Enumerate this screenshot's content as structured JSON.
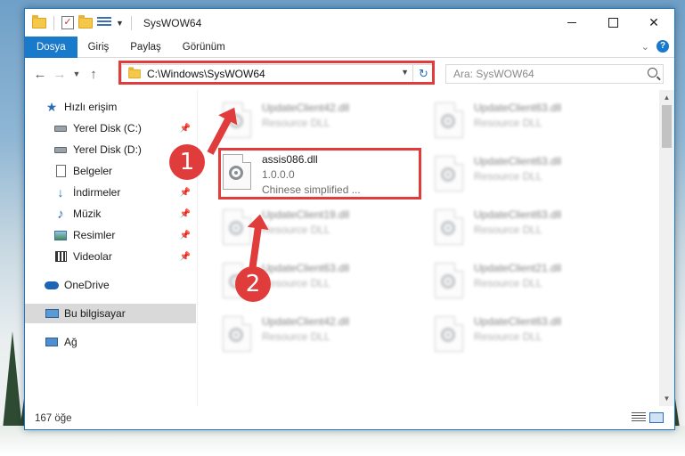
{
  "window": {
    "title": "SysWOW64"
  },
  "ribbon": {
    "tabs": [
      "Dosya",
      "Giriş",
      "Paylaş",
      "Görünüm"
    ],
    "help": "?"
  },
  "address": {
    "path": "C:\\Windows\\SysWOW64",
    "refresh_glyph": "↻"
  },
  "search": {
    "placeholder": "Ara: SysWOW64"
  },
  "sidebar": {
    "items": [
      {
        "label": "Hızlı erişim",
        "icon": "star-icon"
      },
      {
        "label": "Yerel Disk (C:)",
        "icon": "drive-icon",
        "pinned": true
      },
      {
        "label": "Yerel Disk (D:)",
        "icon": "drive-icon"
      },
      {
        "label": "Belgeler",
        "icon": "document-icon"
      },
      {
        "label": "İndirmeler",
        "icon": "download-icon",
        "pinned": true
      },
      {
        "label": "Müzik",
        "icon": "music-icon",
        "pinned": true
      },
      {
        "label": "Resimler",
        "icon": "picture-icon",
        "pinned": true
      },
      {
        "label": "Videolar",
        "icon": "video-icon",
        "pinned": true
      },
      {
        "label": "OneDrive",
        "icon": "cloud-icon"
      },
      {
        "label": "Bu bilgisayar",
        "icon": "computer-icon",
        "selected": true
      },
      {
        "label": "Ağ",
        "icon": "network-icon"
      }
    ],
    "pin_glyph": "📌"
  },
  "files": [
    {
      "name": "UpdateClient42.dll",
      "sub": "Resource DLL",
      "blurred": true
    },
    {
      "name": "UpdateClient63.dll",
      "sub": "Resource DLL",
      "blurred": true
    },
    {
      "name": "assis086.dll",
      "version": "1.0.0.0",
      "sub": "Chinese simplified ...",
      "blurred": false
    },
    {
      "name": "UpdateClient63.dll",
      "sub": "Resource DLL",
      "blurred": true
    },
    {
      "name": "UpdateClient19.dll",
      "sub": "Resource DLL",
      "blurred": true
    },
    {
      "name": "UpdateClient63.dll",
      "sub": "Resource DLL",
      "blurred": true
    },
    {
      "name": "UpdateClient63.dll",
      "sub": "Resource DLL",
      "blurred": true
    },
    {
      "name": "UpdateClient21.dll",
      "sub": "Resource DLL",
      "blurred": true
    },
    {
      "name": "UpdateClient42.dll",
      "sub": "Resource DLL",
      "blurred": true
    },
    {
      "name": "UpdateClient63.dll",
      "sub": "Resource DLL",
      "blurred": true
    }
  ],
  "status": {
    "item_count": "167 öğe"
  },
  "callouts": {
    "one": "1",
    "two": "2"
  },
  "colors": {
    "accent": "#1979ca",
    "highlight": "#e03c3c"
  }
}
